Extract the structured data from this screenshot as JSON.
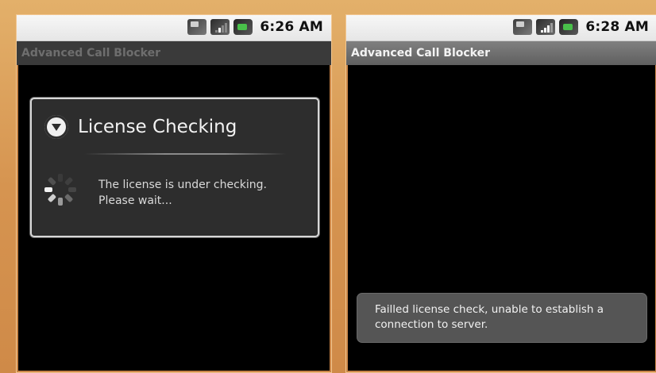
{
  "left_screen": {
    "status_time": "6:26 AM",
    "app_title": "Advanced Call Blocker",
    "dialog": {
      "title": "License Checking",
      "message_line1": "The license is under checking.",
      "message_line2": "Please wait..."
    }
  },
  "right_screen": {
    "status_time": "6:28 AM",
    "app_title": "Advanced Call Blocker",
    "toast": {
      "line1": "Failled license check, unable to establish a",
      "line2": "connection to server."
    }
  },
  "icons": {
    "status": [
      "sim-card-icon",
      "signal-strength-icon",
      "battery-icon"
    ],
    "dialog": "info-arrow-icon",
    "progress": "loading-spinner-icon"
  },
  "colors": {
    "frame": "#d69450",
    "screen_background": "#000000",
    "dialog_background": "#2d2d2d",
    "toast_background": "#555555",
    "battery_fill": "#49c04a"
  }
}
